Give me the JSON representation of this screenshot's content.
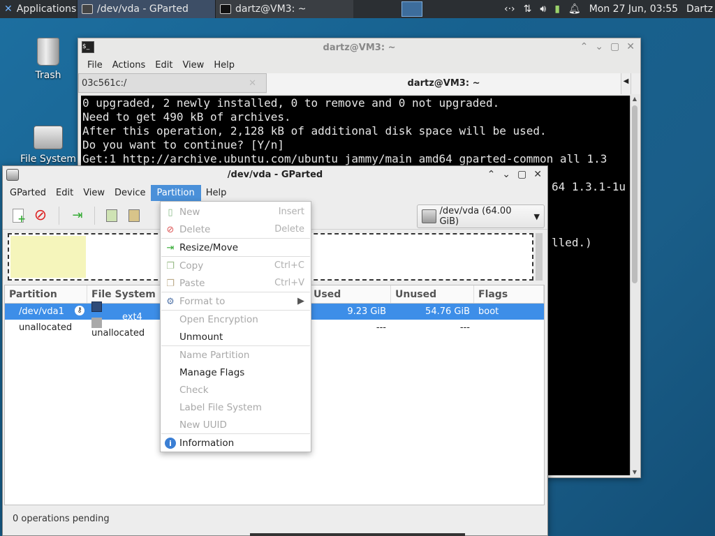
{
  "panel": {
    "applications": "Applications",
    "tasks": [
      {
        "label": "/dev/vda - GParted",
        "active": true
      },
      {
        "label": "dartz@VM3: ~",
        "active": false
      }
    ],
    "clock": "Mon 27 Jun, 03:55",
    "user": "Dartz"
  },
  "desktop": {
    "trash": "Trash",
    "filesystem": "File System"
  },
  "terminal": {
    "title": "dartz@VM3: ~",
    "menu": [
      "File",
      "Actions",
      "Edit",
      "View",
      "Help"
    ],
    "tab1": "03c561c:/",
    "tab2": "dartz@VM3: ~",
    "lines": [
      "0 upgraded, 2 newly installed, 0 to remove and 0 not upgraded.",
      "Need to get 490 kB of archives.",
      "After this operation, 2,128 kB of additional disk space will be used.",
      "Do you want to continue? [Y/n]",
      "Get:1 http://archive.ubuntu.com/ubuntu jammy/main amd64 gparted-common all 1.3"
    ],
    "partial_line_right_1": "64 1.3.1-1u",
    "partial_line_right_2": "lled.)"
  },
  "gparted": {
    "title": "/dev/vda - GParted",
    "menu": [
      "GParted",
      "Edit",
      "View",
      "Device",
      "Partition",
      "Help"
    ],
    "device": "/dev/vda (64.00 GiB)",
    "columns": [
      "Partition",
      "File System",
      "Used",
      "Unused",
      "Flags"
    ],
    "rows": [
      {
        "partition": "/dev/vda1",
        "fs": "ext4",
        "used": "9.23 GiB",
        "unused": "54.76 GiB",
        "flags": "boot",
        "color": "#2f4b78"
      },
      {
        "partition": "unallocated",
        "fs": "unallocated",
        "used": "---",
        "unused": "---",
        "flags": "",
        "color": "#a9a9a9"
      }
    ],
    "status": "0 operations pending"
  },
  "partition_menu": {
    "items": [
      {
        "label": "New",
        "accel": "Insert",
        "enabled": false,
        "icon": "new-icon"
      },
      {
        "label": "Delete",
        "accel": "Delete",
        "enabled": false,
        "icon": "delete-icon"
      },
      {
        "label": "Resize/Move",
        "accel": "",
        "enabled": true,
        "icon": "resize-icon"
      },
      {
        "label": "Copy",
        "accel": "Ctrl+C",
        "enabled": false,
        "icon": "copy-icon"
      },
      {
        "label": "Paste",
        "accel": "Ctrl+V",
        "enabled": false,
        "icon": "paste-icon"
      },
      {
        "label": "Format to",
        "accel": "",
        "enabled": false,
        "icon": "format-icon"
      },
      {
        "label": "Open Encryption",
        "accel": "",
        "enabled": false
      },
      {
        "label": "Unmount",
        "accel": "",
        "enabled": true
      },
      {
        "label": "Name Partition",
        "accel": "",
        "enabled": false
      },
      {
        "label": "Manage Flags",
        "accel": "",
        "enabled": true
      },
      {
        "label": "Check",
        "accel": "",
        "enabled": false
      },
      {
        "label": "Label File System",
        "accel": "",
        "enabled": false
      },
      {
        "label": "New UUID",
        "accel": "",
        "enabled": false
      },
      {
        "label": "Information",
        "accel": "",
        "enabled": true,
        "icon": "info-icon"
      }
    ]
  }
}
